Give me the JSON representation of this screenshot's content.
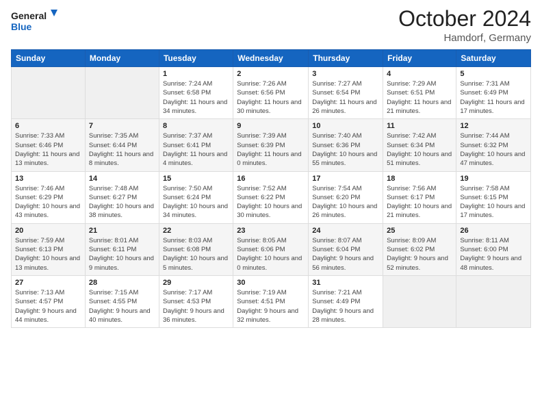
{
  "header": {
    "logo_line1": "General",
    "logo_line2": "Blue",
    "month": "October 2024",
    "location": "Hamdorf, Germany"
  },
  "weekdays": [
    "Sunday",
    "Monday",
    "Tuesday",
    "Wednesday",
    "Thursday",
    "Friday",
    "Saturday"
  ],
  "weeks": [
    [
      {
        "day": "",
        "info": ""
      },
      {
        "day": "",
        "info": ""
      },
      {
        "day": "1",
        "info": "Sunrise: 7:24 AM\nSunset: 6:58 PM\nDaylight: 11 hours and 34 minutes."
      },
      {
        "day": "2",
        "info": "Sunrise: 7:26 AM\nSunset: 6:56 PM\nDaylight: 11 hours and 30 minutes."
      },
      {
        "day": "3",
        "info": "Sunrise: 7:27 AM\nSunset: 6:54 PM\nDaylight: 11 hours and 26 minutes."
      },
      {
        "day": "4",
        "info": "Sunrise: 7:29 AM\nSunset: 6:51 PM\nDaylight: 11 hours and 21 minutes."
      },
      {
        "day": "5",
        "info": "Sunrise: 7:31 AM\nSunset: 6:49 PM\nDaylight: 11 hours and 17 minutes."
      }
    ],
    [
      {
        "day": "6",
        "info": "Sunrise: 7:33 AM\nSunset: 6:46 PM\nDaylight: 11 hours and 13 minutes."
      },
      {
        "day": "7",
        "info": "Sunrise: 7:35 AM\nSunset: 6:44 PM\nDaylight: 11 hours and 8 minutes."
      },
      {
        "day": "8",
        "info": "Sunrise: 7:37 AM\nSunset: 6:41 PM\nDaylight: 11 hours and 4 minutes."
      },
      {
        "day": "9",
        "info": "Sunrise: 7:39 AM\nSunset: 6:39 PM\nDaylight: 11 hours and 0 minutes."
      },
      {
        "day": "10",
        "info": "Sunrise: 7:40 AM\nSunset: 6:36 PM\nDaylight: 10 hours and 55 minutes."
      },
      {
        "day": "11",
        "info": "Sunrise: 7:42 AM\nSunset: 6:34 PM\nDaylight: 10 hours and 51 minutes."
      },
      {
        "day": "12",
        "info": "Sunrise: 7:44 AM\nSunset: 6:32 PM\nDaylight: 10 hours and 47 minutes."
      }
    ],
    [
      {
        "day": "13",
        "info": "Sunrise: 7:46 AM\nSunset: 6:29 PM\nDaylight: 10 hours and 43 minutes."
      },
      {
        "day": "14",
        "info": "Sunrise: 7:48 AM\nSunset: 6:27 PM\nDaylight: 10 hours and 38 minutes."
      },
      {
        "day": "15",
        "info": "Sunrise: 7:50 AM\nSunset: 6:24 PM\nDaylight: 10 hours and 34 minutes."
      },
      {
        "day": "16",
        "info": "Sunrise: 7:52 AM\nSunset: 6:22 PM\nDaylight: 10 hours and 30 minutes."
      },
      {
        "day": "17",
        "info": "Sunrise: 7:54 AM\nSunset: 6:20 PM\nDaylight: 10 hours and 26 minutes."
      },
      {
        "day": "18",
        "info": "Sunrise: 7:56 AM\nSunset: 6:17 PM\nDaylight: 10 hours and 21 minutes."
      },
      {
        "day": "19",
        "info": "Sunrise: 7:58 AM\nSunset: 6:15 PM\nDaylight: 10 hours and 17 minutes."
      }
    ],
    [
      {
        "day": "20",
        "info": "Sunrise: 7:59 AM\nSunset: 6:13 PM\nDaylight: 10 hours and 13 minutes."
      },
      {
        "day": "21",
        "info": "Sunrise: 8:01 AM\nSunset: 6:11 PM\nDaylight: 10 hours and 9 minutes."
      },
      {
        "day": "22",
        "info": "Sunrise: 8:03 AM\nSunset: 6:08 PM\nDaylight: 10 hours and 5 minutes."
      },
      {
        "day": "23",
        "info": "Sunrise: 8:05 AM\nSunset: 6:06 PM\nDaylight: 10 hours and 0 minutes."
      },
      {
        "day": "24",
        "info": "Sunrise: 8:07 AM\nSunset: 6:04 PM\nDaylight: 9 hours and 56 minutes."
      },
      {
        "day": "25",
        "info": "Sunrise: 8:09 AM\nSunset: 6:02 PM\nDaylight: 9 hours and 52 minutes."
      },
      {
        "day": "26",
        "info": "Sunrise: 8:11 AM\nSunset: 6:00 PM\nDaylight: 9 hours and 48 minutes."
      }
    ],
    [
      {
        "day": "27",
        "info": "Sunrise: 7:13 AM\nSunset: 4:57 PM\nDaylight: 9 hours and 44 minutes."
      },
      {
        "day": "28",
        "info": "Sunrise: 7:15 AM\nSunset: 4:55 PM\nDaylight: 9 hours and 40 minutes."
      },
      {
        "day": "29",
        "info": "Sunrise: 7:17 AM\nSunset: 4:53 PM\nDaylight: 9 hours and 36 minutes."
      },
      {
        "day": "30",
        "info": "Sunrise: 7:19 AM\nSunset: 4:51 PM\nDaylight: 9 hours and 32 minutes."
      },
      {
        "day": "31",
        "info": "Sunrise: 7:21 AM\nSunset: 4:49 PM\nDaylight: 9 hours and 28 minutes."
      },
      {
        "day": "",
        "info": ""
      },
      {
        "day": "",
        "info": ""
      }
    ]
  ]
}
